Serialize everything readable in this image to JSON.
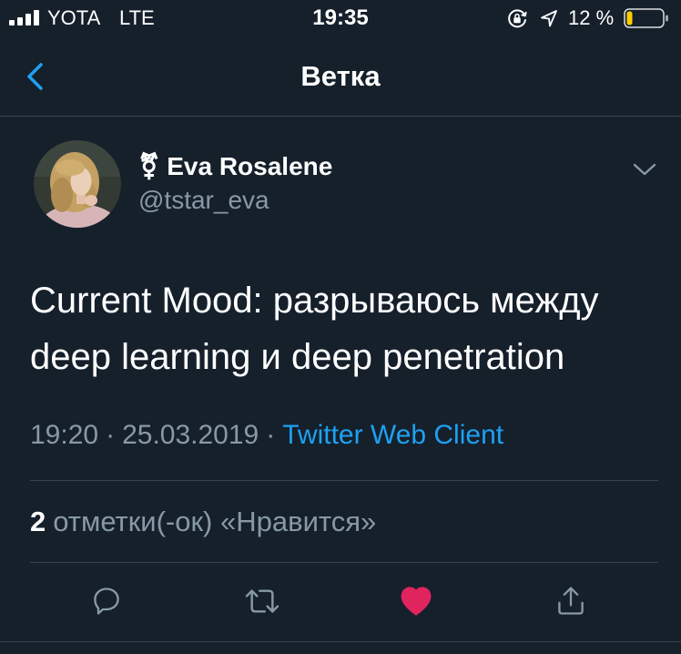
{
  "status_bar": {
    "signal_icon": "signal-bars-icon",
    "carrier": "YOTA",
    "network": "LTE",
    "time": "19:35",
    "rotation_lock_icon": "rotation-lock-icon",
    "location_icon": "location-arrow-icon",
    "battery_text": "12 %",
    "battery_level_percent": 12,
    "battery_icon": "battery-icon"
  },
  "nav": {
    "back_icon": "chevron-left-icon",
    "title": "Ветка"
  },
  "tweet": {
    "author": {
      "display_name": "⚧ Eva Rosalene",
      "handle": "@tstar_eva"
    },
    "menu_icon": "chevron-down-icon",
    "text_lines": [
      "Current Mood: разрываюсь между",
      "deep learning и deep penetration"
    ],
    "meta": {
      "time": "19:20",
      "separator": "·",
      "date": "25.03.2019",
      "source": "Twitter Web Client"
    },
    "likes": {
      "count": "2",
      "label": "отметки(-ок) «Нравится»"
    },
    "actions": [
      {
        "icon": "reply-icon"
      },
      {
        "icon": "retweet-icon"
      },
      {
        "icon": "heart-icon",
        "liked": true
      },
      {
        "icon": "share-icon"
      }
    ]
  },
  "colors": {
    "background": "#15202b",
    "text_primary": "#ffffff",
    "text_secondary": "#8899a6",
    "accent": "#1da1f2",
    "divider": "#38444d",
    "like_active": "#e0245e",
    "battery_low": "#ffcc00"
  }
}
